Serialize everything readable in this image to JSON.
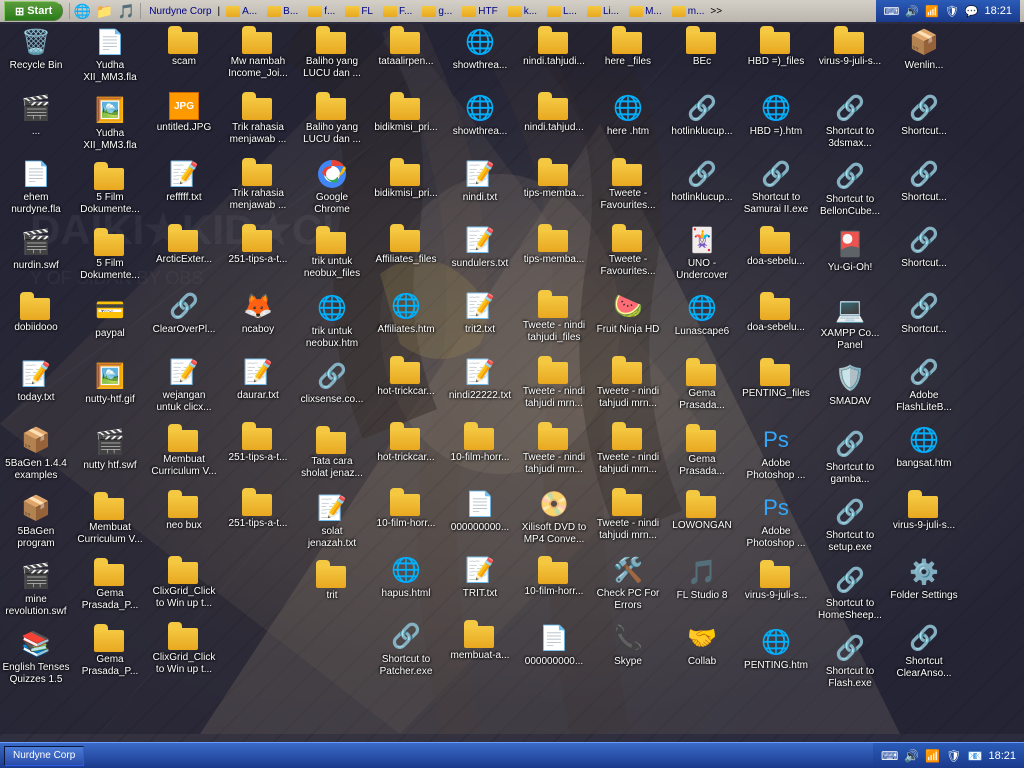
{
  "taskbar": {
    "start_label": "Start",
    "time": "18:21",
    "items": [
      {
        "label": "Nurdyne Corp"
      }
    ],
    "tray_icons": [
      "🔊",
      "🌐",
      "🛡️",
      "💬"
    ]
  },
  "toolbar": {
    "folders": [
      "A...",
      "B...",
      "f...",
      "FL",
      "F...",
      "g...",
      "HTF",
      "k...",
      "L...",
      "Li...",
      "M...",
      "m..."
    ]
  },
  "desktop": {
    "banner_text": "DAIKI★KID★CI",
    "banner_sub": "Y OF SIDAN BY OBS",
    "bg_color": "#2a2a3a"
  },
  "icons": [
    {
      "col": 0,
      "items": [
        {
          "label": "Recycle Bin",
          "type": "recycle",
          "icon": "🗑️"
        },
        {
          "label": "...",
          "type": "swf",
          "icon": "📄"
        },
        {
          "label": "ehem nurdyne.fla",
          "type": "file",
          "icon": "📄"
        },
        {
          "label": "nurdin.swf",
          "type": "swf",
          "icon": "🎬"
        },
        {
          "label": "dobiidooo",
          "type": "folder",
          "icon": "📁"
        },
        {
          "label": "today.txt",
          "type": "txt",
          "icon": "📝"
        },
        {
          "label": "5BaGen 1.4.4 examples",
          "type": "folder",
          "icon": "📁"
        },
        {
          "label": "5BaGen program",
          "type": "folder",
          "icon": "📁"
        },
        {
          "label": "mine revolution.swf",
          "type": "swf",
          "icon": "🎬"
        },
        {
          "label": "English Tenses Quizzes 1.5",
          "type": "exe",
          "icon": "📦"
        }
      ]
    },
    {
      "col": 1,
      "items": [
        {
          "label": "Yudha XII_MM3.fla",
          "type": "file",
          "icon": "📄"
        },
        {
          "label": "Yudha XII_MM3.fla",
          "type": "file",
          "icon": "📄"
        },
        {
          "label": "5 Film Dokumente...",
          "type": "folder",
          "icon": "📁"
        },
        {
          "label": "5 Film Dokumente...",
          "type": "folder",
          "icon": "📁"
        },
        {
          "label": "paypal",
          "type": "file",
          "icon": "📄"
        },
        {
          "label": "nutty-htf.gif",
          "type": "img",
          "icon": "🖼️"
        },
        {
          "label": "nutty htf.swf",
          "type": "swf",
          "icon": "🎬"
        },
        {
          "label": "Membuat Curriculum V...",
          "type": "folder",
          "icon": "📁"
        },
        {
          "label": "Gema Prasada_P...",
          "type": "folder",
          "icon": "📁"
        },
        {
          "label": "Gema Prasada_P...",
          "type": "folder",
          "icon": "📁"
        }
      ]
    },
    {
      "col": 2,
      "items": [
        {
          "label": "scam",
          "type": "folder",
          "icon": "📁"
        },
        {
          "label": "untitled.JPG",
          "type": "img",
          "icon": "🖼️"
        },
        {
          "label": "refffff.txt",
          "type": "txt",
          "icon": "📝"
        },
        {
          "label": "ArcticExter...",
          "type": "folder",
          "icon": "📁"
        },
        {
          "label": "ClearOverPl...",
          "type": "shortcut",
          "icon": "🔗"
        },
        {
          "label": "Membuat Curriculum V...",
          "type": "folder",
          "icon": "📁"
        },
        {
          "label": "neo bux",
          "type": "folder",
          "icon": "📁"
        },
        {
          "label": "ClixGrid_Click to Win up t...",
          "type": "folder",
          "icon": "📁"
        },
        {
          "label": "ClixGrid_Click to Win up t...",
          "type": "folder",
          "icon": "📁"
        }
      ]
    },
    {
      "col": 3,
      "items": [
        {
          "label": "Mw nambah Income_Joi...",
          "type": "folder",
          "icon": "📁"
        },
        {
          "label": "Trik rahasia menjawab ...",
          "type": "folder",
          "icon": "📁"
        },
        {
          "label": "wejangan untuk clicx...",
          "type": "txt",
          "icon": "📝"
        },
        {
          "label": "Trik rahasia menjawab ...",
          "type": "folder",
          "icon": "📁"
        },
        {
          "label": "ncaboy",
          "type": "exe",
          "icon": "📦"
        },
        {
          "label": "daurar.txt",
          "type": "txt",
          "icon": "📝"
        },
        {
          "label": "251-tips-a-t...",
          "type": "folder",
          "icon": "📁"
        },
        {
          "label": "251-tips-a-t...",
          "type": "folder",
          "icon": "📁"
        }
      ]
    },
    {
      "col": 4,
      "items": [
        {
          "label": "Baliho yang LUCU dan ...",
          "type": "folder",
          "icon": "📁"
        },
        {
          "label": "Baliho yang LUCU dan ...",
          "type": "folder",
          "icon": "📁"
        },
        {
          "label": "Google Chrome",
          "type": "exe",
          "icon": "🌐"
        },
        {
          "label": "trik untuk neobux_files",
          "type": "folder",
          "icon": "📁"
        },
        {
          "label": "trik untuk neobux.htm",
          "type": "htm",
          "icon": "🌐"
        },
        {
          "label": "clixsense.co...",
          "type": "shortcut",
          "icon": "🔗"
        },
        {
          "label": "Tata cara sholat jenaz...",
          "type": "folder",
          "icon": "📁"
        },
        {
          "label": "solat jenazah.txt",
          "type": "txt",
          "icon": "📝"
        },
        {
          "label": "trit",
          "type": "folder",
          "icon": "📁"
        }
      ]
    },
    {
      "col": 5,
      "items": [
        {
          "label": "tataalirpen...",
          "type": "folder",
          "icon": "📁"
        },
        {
          "label": "bidikmisi_pri...",
          "type": "folder",
          "icon": "📁"
        },
        {
          "label": "bidikmisi_pri...",
          "type": "folder",
          "icon": "📁"
        },
        {
          "label": "Affiliates_files",
          "type": "folder",
          "icon": "📁"
        },
        {
          "label": "Affiliates.htm",
          "type": "htm",
          "icon": "🌐"
        },
        {
          "label": "hot-trickcar...",
          "type": "folder",
          "icon": "📁"
        },
        {
          "label": "hot-trickcar...",
          "type": "folder",
          "icon": "📁"
        },
        {
          "label": "10-film-horr...",
          "type": "folder",
          "icon": "📁"
        },
        {
          "label": "hapus.html",
          "type": "htm",
          "icon": "🌐"
        },
        {
          "label": "Shortcut to Patcher.exe",
          "type": "shortcut",
          "icon": "🔗"
        }
      ]
    },
    {
      "col": 6,
      "items": [
        {
          "label": "showthrea...",
          "type": "htm",
          "icon": "🌐"
        },
        {
          "label": "showthrea...",
          "type": "htm",
          "icon": "🌐"
        },
        {
          "label": "nindi.txt",
          "type": "txt",
          "icon": "📝"
        },
        {
          "label": "sundulers.txt",
          "type": "txt",
          "icon": "📝"
        },
        {
          "label": "trit2.txt",
          "type": "txt",
          "icon": "📝"
        },
        {
          "label": "nindi22222.txt",
          "type": "txt",
          "icon": "📝"
        },
        {
          "label": "10-film-horr...",
          "type": "folder",
          "icon": "📁"
        },
        {
          "label": "000000000...",
          "type": "file",
          "icon": "📄"
        },
        {
          "label": "TRIT.txt",
          "type": "txt",
          "icon": "📝"
        },
        {
          "label": "membuat-a...",
          "type": "folder",
          "icon": "📁"
        }
      ]
    },
    {
      "col": 7,
      "items": [
        {
          "label": "nindi.tahjudi...",
          "type": "folder",
          "icon": "📁"
        },
        {
          "label": "nindi.tahjud...",
          "type": "folder",
          "icon": "📁"
        },
        {
          "label": "tips-memba...",
          "type": "folder",
          "icon": "📁"
        },
        {
          "label": "tips-memba...",
          "type": "folder",
          "icon": "📁"
        },
        {
          "label": "Tweete - nindi tahjudi_files",
          "type": "folder",
          "icon": "📁"
        },
        {
          "label": "Tweete - nindi tahjudi mrn...",
          "type": "folder",
          "icon": "📁"
        },
        {
          "label": "Tweete - nindi tahjudi mrn...",
          "type": "folder",
          "icon": "📁"
        },
        {
          "label": "Xilisoft DVD to MP4 Conve...",
          "type": "exe",
          "icon": "📦"
        },
        {
          "label": "10-film-horr...",
          "type": "folder",
          "icon": "📁"
        },
        {
          "label": "000000000...",
          "type": "file",
          "icon": "📄"
        }
      ]
    },
    {
      "col": 8,
      "items": [
        {
          "label": "here _files",
          "type": "folder",
          "icon": "📁"
        },
        {
          "label": "here .htm",
          "type": "htm",
          "icon": "🌐"
        },
        {
          "label": "Tweete - Favourites...",
          "type": "folder",
          "icon": "📁"
        },
        {
          "label": "Tweete - Favourites...",
          "type": "folder",
          "icon": "📁"
        },
        {
          "label": "Fruit Ninja HD",
          "type": "exe",
          "icon": "🎮"
        },
        {
          "label": "Tweete - nindi tahjudi mrn...",
          "type": "folder",
          "icon": "📁"
        },
        {
          "label": "Tweete - nindi tahjudi mrn...",
          "type": "folder",
          "icon": "📁"
        },
        {
          "label": "Tweete - nindi tahjudi mrn...",
          "type": "folder",
          "icon": "📁"
        },
        {
          "label": "Check PC For Errors",
          "type": "exe",
          "icon": "🛠️"
        },
        {
          "label": "Skype",
          "type": "exe",
          "icon": "📞"
        }
      ]
    },
    {
      "col": 9,
      "items": [
        {
          "label": "BEc",
          "type": "folder",
          "icon": "📁"
        },
        {
          "label": "hotlinklucup...",
          "type": "shortcut",
          "icon": "🔗"
        },
        {
          "label": "hotlinklucup...",
          "type": "shortcut",
          "icon": "🔗"
        },
        {
          "label": "UNO - Undercover",
          "type": "folder",
          "icon": "📁"
        },
        {
          "label": "Lunascape6",
          "type": "exe",
          "icon": "🌐"
        },
        {
          "label": "Gema Prasada...",
          "type": "folder",
          "icon": "📁"
        },
        {
          "label": "Gema Prasada...",
          "type": "folder",
          "icon": "📁"
        },
        {
          "label": "LOWONGAN",
          "type": "folder",
          "icon": "📁"
        },
        {
          "label": "FL Studio 8",
          "type": "exe",
          "icon": "🎵"
        },
        {
          "label": "Collab",
          "type": "exe",
          "icon": "🤝"
        }
      ]
    },
    {
      "col": 10,
      "items": [
        {
          "label": "HBD =)_files",
          "type": "folder",
          "icon": "📁"
        },
        {
          "label": "HBD =).htm",
          "type": "htm",
          "icon": "🌐"
        },
        {
          "label": "Shortcut to Samurai II.exe",
          "type": "shortcut",
          "icon": "🔗"
        },
        {
          "label": "doa-sebelu...",
          "type": "folder",
          "icon": "📁"
        },
        {
          "label": "doa-sebelu...",
          "type": "folder",
          "icon": "📁"
        },
        {
          "label": "PENTING_files",
          "type": "folder",
          "icon": "📁"
        },
        {
          "label": "Adobe Photoshop ...",
          "type": "shortcut",
          "icon": "🔗"
        },
        {
          "label": "Adobe Photoshop ...",
          "type": "shortcut",
          "icon": "🔗"
        },
        {
          "label": "virus-9-juli-s...",
          "type": "folder",
          "icon": "📁"
        },
        {
          "label": "PENTING.htm",
          "type": "htm",
          "icon": "🌐"
        }
      ]
    },
    {
      "col": 11,
      "items": [
        {
          "label": "virus-9-juli-s...",
          "type": "folder",
          "icon": "📁"
        },
        {
          "label": "Shortcut to 3dsmax...",
          "type": "shortcut",
          "icon": "🔗"
        },
        {
          "label": "Shortcut to BellonCube...",
          "type": "shortcut",
          "icon": "🔗"
        },
        {
          "label": "Yu-Gi-Oh!",
          "type": "exe",
          "icon": "🎴"
        },
        {
          "label": "XAMPP Co... Panel",
          "type": "exe",
          "icon": "💻"
        },
        {
          "label": "Shortcut to gamba...",
          "type": "shortcut",
          "icon": "🔗"
        },
        {
          "label": "SMADAV",
          "type": "exe",
          "icon": "🛡️"
        },
        {
          "label": "Shortcut to setup.exe",
          "type": "shortcut",
          "icon": "🔗"
        },
        {
          "label": "Shortcut to HomeSheep...",
          "type": "shortcut",
          "icon": "🔗"
        },
        {
          "label": "Shortcut to Flash.exe",
          "type": "shortcut",
          "icon": "🔗"
        },
        {
          "label": "Adobe FlashLiteB...",
          "type": "shortcut",
          "icon": "🔗"
        },
        {
          "label": "bangsat.htm",
          "type": "htm",
          "icon": "🌐"
        },
        {
          "label": "Folder Settings",
          "type": "folder",
          "icon": "📁"
        },
        {
          "label": "Shortcut ClearAnso...",
          "type": "shortcut",
          "icon": "🔗"
        }
      ]
    }
  ]
}
